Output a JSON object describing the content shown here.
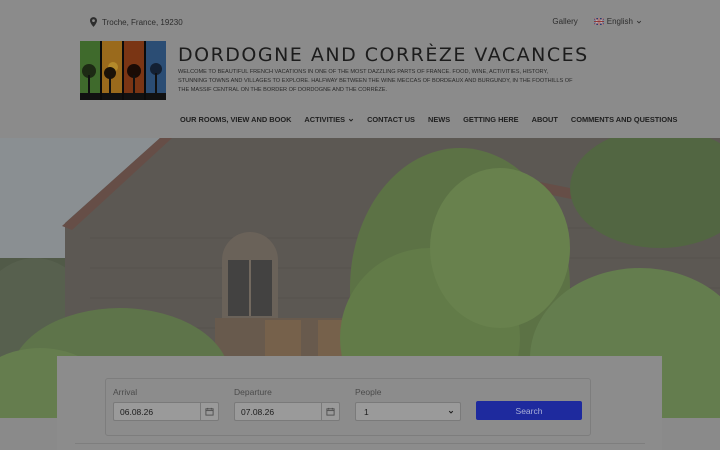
{
  "topbar": {
    "location": "Troche, France, 19230",
    "gallery_label": "Gallery",
    "language_label": "English"
  },
  "site": {
    "title": "DORDOGNE AND CORRÈZE VACANCES",
    "description": "WELCOME TO BEAUTIFUL FRENCH VACATIONS IN ONE OF THE MOST DAZZLING PARTS OF FRANCE. FOOD, WINE, ACTIVITIES, HISTORY, STUNNING TOWNS AND VILLAGES TO EXPLORE. HALFWAY BETWEEN THE WINE MECCAS OF BORDEAUX AND BURGUNDY, IN THE FOOTHILLS OF THE MASSIF CENTRAL ON THE BORDER OF DORDOGNE AND THE CORRÈZE."
  },
  "nav": {
    "items": [
      {
        "label": "OUR ROOMS, VIEW AND BOOK"
      },
      {
        "label": "ACTIVITIES"
      },
      {
        "label": "CONTACT US"
      },
      {
        "label": "NEWS"
      },
      {
        "label": "GETTING HERE"
      },
      {
        "label": "ABOUT"
      },
      {
        "label": "COMMENTS AND QUESTIONS"
      }
    ]
  },
  "booking": {
    "arrival_label": "Arrival",
    "arrival_value": "06.08.26",
    "departure_label": "Departure",
    "departure_value": "07.08.26",
    "people_label": "People",
    "people_value": "1",
    "search_label": "Search"
  },
  "icons": {
    "location": "map-pin-icon",
    "language": "uk-flag-icon",
    "dropdown": "chevron-down-icon",
    "calendar": "calendar-icon"
  },
  "colors": {
    "overlay": "#8a8a8a",
    "search_button": "#1e2a9e"
  }
}
